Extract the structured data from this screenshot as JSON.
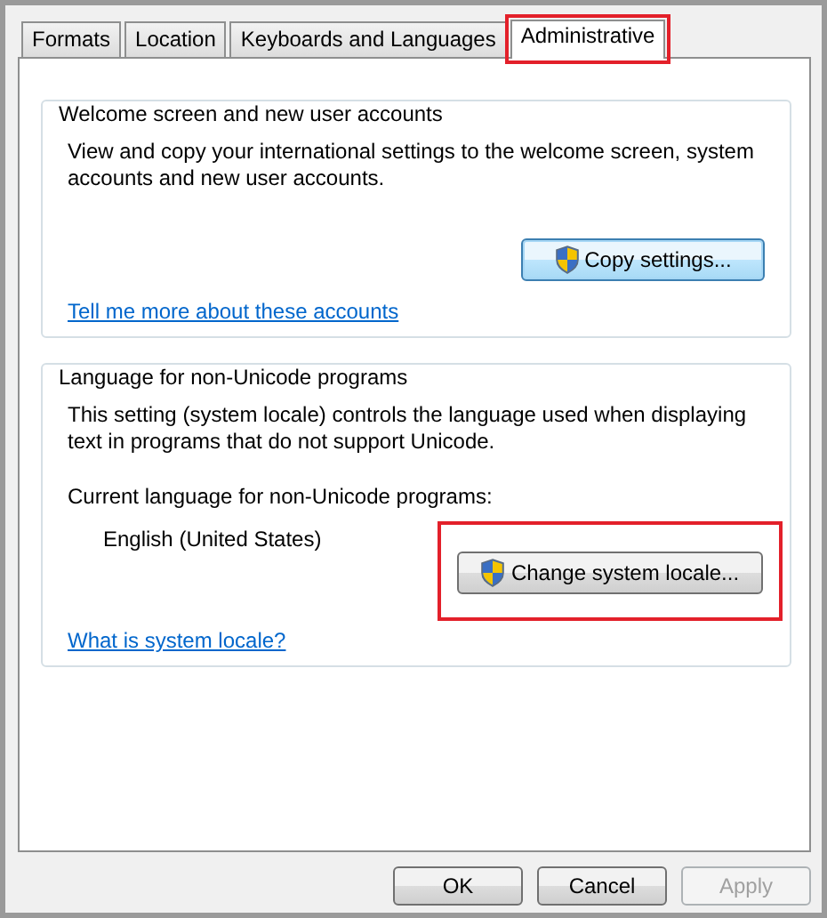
{
  "tabs": [
    {
      "label": "Formats",
      "selected": false,
      "highlighted": false
    },
    {
      "label": "Location",
      "selected": false,
      "highlighted": false
    },
    {
      "label": "Keyboards and Languages",
      "selected": false,
      "highlighted": false
    },
    {
      "label": "Administrative",
      "selected": true,
      "highlighted": true
    }
  ],
  "groups": [
    {
      "title": "Welcome screen and new user accounts",
      "description": "View and copy your international settings to the welcome screen, system accounts and new user accounts.",
      "button": {
        "label": "Copy settings...",
        "default": true,
        "highlighted": false
      },
      "link": "Tell me more about these accounts"
    },
    {
      "title": "Language for non-Unicode programs",
      "description": "This setting (system locale) controls the language used when displaying text in programs that do not support Unicode.",
      "current_label": "Current language for non-Unicode programs:",
      "current_value": "English (United States)",
      "button": {
        "label": "Change system locale...",
        "default": false,
        "highlighted": true
      },
      "link": "What is system locale?"
    }
  ],
  "buttons": [
    {
      "label": "OK",
      "disabled": false
    },
    {
      "label": "Cancel",
      "disabled": false
    },
    {
      "label": "Apply",
      "disabled": true
    }
  ]
}
